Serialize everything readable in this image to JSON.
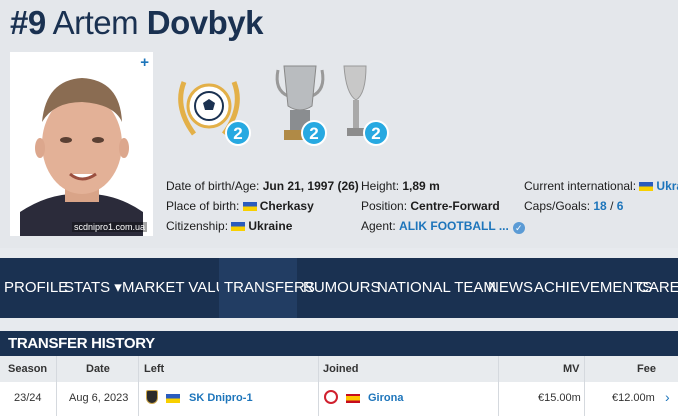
{
  "player": {
    "number": "#9",
    "first_name": "Artem",
    "last_name": "Dovbyk",
    "photo_credit": "scdnipro1.com.ua"
  },
  "trophies": [
    {
      "icon": "ball-laurel-icon",
      "count": "2"
    },
    {
      "icon": "cup-trophy-icon",
      "count": "2"
    },
    {
      "icon": "chalice-trophy-icon",
      "count": "2"
    }
  ],
  "info": {
    "dob_label": "Date of birth/Age:",
    "dob_value": "Jun 21, 1997 (26)",
    "pob_label": "Place of birth:",
    "pob_value": "Cherkasy",
    "citizenship_label": "Citizenship:",
    "citizenship_value": "Ukraine",
    "height_label": "Height:",
    "height_value": "1,89 m",
    "position_label": "Position:",
    "position_value": "Centre-Forward",
    "agent_label": "Agent:",
    "agent_value": "ALIK FOOTBALL ...",
    "intl_label": "Current international:",
    "intl_value": "Ukra",
    "caps_label": "Caps/Goals:",
    "caps_value": "18",
    "goals_value": "6",
    "caps_sep": " / "
  },
  "nav": [
    {
      "label": "PROFILE",
      "active": false
    },
    {
      "label": "STATS ▾",
      "active": false
    },
    {
      "label": "MARKET VALUE",
      "active": false
    },
    {
      "label": "TRANSFERS",
      "active": true
    },
    {
      "label": "RUMOURS",
      "active": false
    },
    {
      "label": "NATIONAL TEAM",
      "active": false
    },
    {
      "label": "NEWS",
      "active": false
    },
    {
      "label": "ACHIEVEMENTS",
      "active": false
    },
    {
      "label": "CAREE",
      "active": false
    }
  ],
  "transfer_history": {
    "title": "TRANSFER HISTORY",
    "columns": [
      "Season",
      "Date",
      "Left",
      "Joined",
      "MV",
      "Fee"
    ],
    "rows": [
      {
        "season": "23/24",
        "date": "Aug 6, 2023",
        "left": "SK Dnipro-1",
        "joined": "Girona",
        "mv": "€15.00m",
        "fee": "€12.00m"
      }
    ]
  },
  "colors": {
    "navy": "#1a3151",
    "accent": "#1d75bb",
    "badge": "#27a9e1"
  }
}
